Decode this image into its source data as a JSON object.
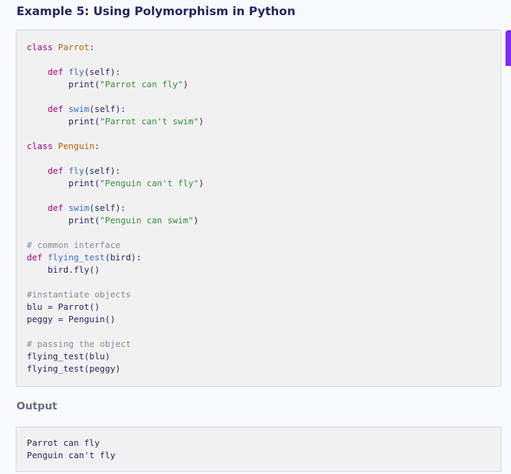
{
  "page": {
    "heading": "Example 5: Using Polymorphism in Python",
    "output_label": "Output",
    "accent_color": "#7a2cf0"
  },
  "code": {
    "lines": [
      [
        {
          "t": "class",
          "c": "kw"
        },
        {
          "t": " "
        },
        {
          "t": "Parrot",
          "c": "cls"
        },
        {
          "t": ":"
        }
      ],
      [],
      [
        {
          "t": "    "
        },
        {
          "t": "def",
          "c": "kw"
        },
        {
          "t": " "
        },
        {
          "t": "fly",
          "c": "fn"
        },
        {
          "t": "(self):"
        }
      ],
      [
        {
          "t": "        print("
        },
        {
          "t": "\"Parrot can fly\"",
          "c": "str"
        },
        {
          "t": ")"
        }
      ],
      [],
      [
        {
          "t": "    "
        },
        {
          "t": "def",
          "c": "kw"
        },
        {
          "t": " "
        },
        {
          "t": "swim",
          "c": "fn"
        },
        {
          "t": "(self):"
        }
      ],
      [
        {
          "t": "        print("
        },
        {
          "t": "\"Parrot can't swim\"",
          "c": "str"
        },
        {
          "t": ")"
        }
      ],
      [],
      [
        {
          "t": "class",
          "c": "kw"
        },
        {
          "t": " "
        },
        {
          "t": "Penguin",
          "c": "cls"
        },
        {
          "t": ":"
        }
      ],
      [],
      [
        {
          "t": "    "
        },
        {
          "t": "def",
          "c": "kw"
        },
        {
          "t": " "
        },
        {
          "t": "fly",
          "c": "fn"
        },
        {
          "t": "(self):"
        }
      ],
      [
        {
          "t": "        print("
        },
        {
          "t": "\"Penguin can't fly\"",
          "c": "str"
        },
        {
          "t": ")"
        }
      ],
      [],
      [
        {
          "t": "    "
        },
        {
          "t": "def",
          "c": "kw"
        },
        {
          "t": " "
        },
        {
          "t": "swim",
          "c": "fn"
        },
        {
          "t": "(self):"
        }
      ],
      [
        {
          "t": "        print("
        },
        {
          "t": "\"Penguin can swim\"",
          "c": "str"
        },
        {
          "t": ")"
        }
      ],
      [],
      [
        {
          "t": "# common interface",
          "c": "cm"
        }
      ],
      [
        {
          "t": "def",
          "c": "kw"
        },
        {
          "t": " "
        },
        {
          "t": "flying_test",
          "c": "fn"
        },
        {
          "t": "(bird):"
        }
      ],
      [
        {
          "t": "    bird.fly()"
        }
      ],
      [],
      [
        {
          "t": "#instantiate objects",
          "c": "cm"
        }
      ],
      [
        {
          "t": "blu = Parrot()"
        }
      ],
      [
        {
          "t": "peggy = Penguin()"
        }
      ],
      [],
      [
        {
          "t": "# passing the object",
          "c": "cm"
        }
      ],
      [
        {
          "t": "flying_test(blu)"
        }
      ],
      [
        {
          "t": "flying_test(peggy)"
        }
      ]
    ]
  },
  "output": {
    "lines": [
      "Parrot can fly",
      "Penguin can't fly"
    ]
  }
}
